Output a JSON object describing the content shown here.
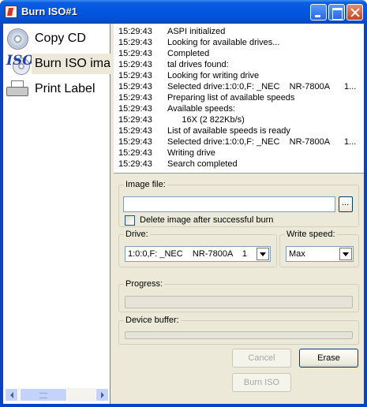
{
  "window": {
    "title": "Burn ISO#1"
  },
  "nav": {
    "items": [
      {
        "label": "Copy CD",
        "icon": "cd-icon",
        "selected": false
      },
      {
        "label": "Burn ISO image",
        "icon": "iso-icon",
        "selected": true
      },
      {
        "label": "Print Label",
        "icon": "printer-icon",
        "selected": false
      }
    ]
  },
  "log": {
    "entries": [
      {
        "time": "15:29:43",
        "message": "ASPI initialized",
        "extra": ""
      },
      {
        "time": "15:29:43",
        "message": "Looking for available drives...",
        "extra": ""
      },
      {
        "time": "15:29:43",
        "message": "Completed",
        "extra": ""
      },
      {
        "time": "15:29:43",
        "message": "tal drives found:",
        "extra": ""
      },
      {
        "time": "15:29:43",
        "message": "Looking for writing drive",
        "extra": ""
      },
      {
        "time": "15:29:43",
        "message": "Selected drive:1:0:0,F: _NEC    NR-7800A",
        "extra": "1..."
      },
      {
        "time": "15:29:43",
        "message": "Preparing list of available speeds",
        "extra": ""
      },
      {
        "time": "15:29:43",
        "message": "Available speeds:",
        "extra": ""
      },
      {
        "time": "15:29:43",
        "message": "      16X (2 822Kb/s)",
        "extra": ""
      },
      {
        "time": "15:29:43",
        "message": "List of available speeds is ready",
        "extra": ""
      },
      {
        "time": "15:29:43",
        "message": "Selected drive:1:0:0,F: _NEC    NR-7800A",
        "extra": "1..."
      },
      {
        "time": "15:29:43",
        "message": "Writing drive",
        "extra": ""
      },
      {
        "time": "15:29:43",
        "message": "Search completed",
        "extra": ""
      }
    ]
  },
  "image_file": {
    "group_label": "Image file:",
    "value": "",
    "delete_checkbox_label": "Delete image after successful burn",
    "delete_checked": false
  },
  "drive": {
    "group_label": "Drive:",
    "selected": "1:0:0,F: _NEC    NR-7800A    1"
  },
  "write_speed": {
    "group_label": "Write speed:",
    "selected": "Max"
  },
  "progress": {
    "group_label": "Progress:",
    "value": 0
  },
  "device_buffer": {
    "group_label": "Device buffer:",
    "value": 0
  },
  "buttons": {
    "cancel": "Cancel",
    "erase": "Erase",
    "burn": "Burn ISO"
  }
}
